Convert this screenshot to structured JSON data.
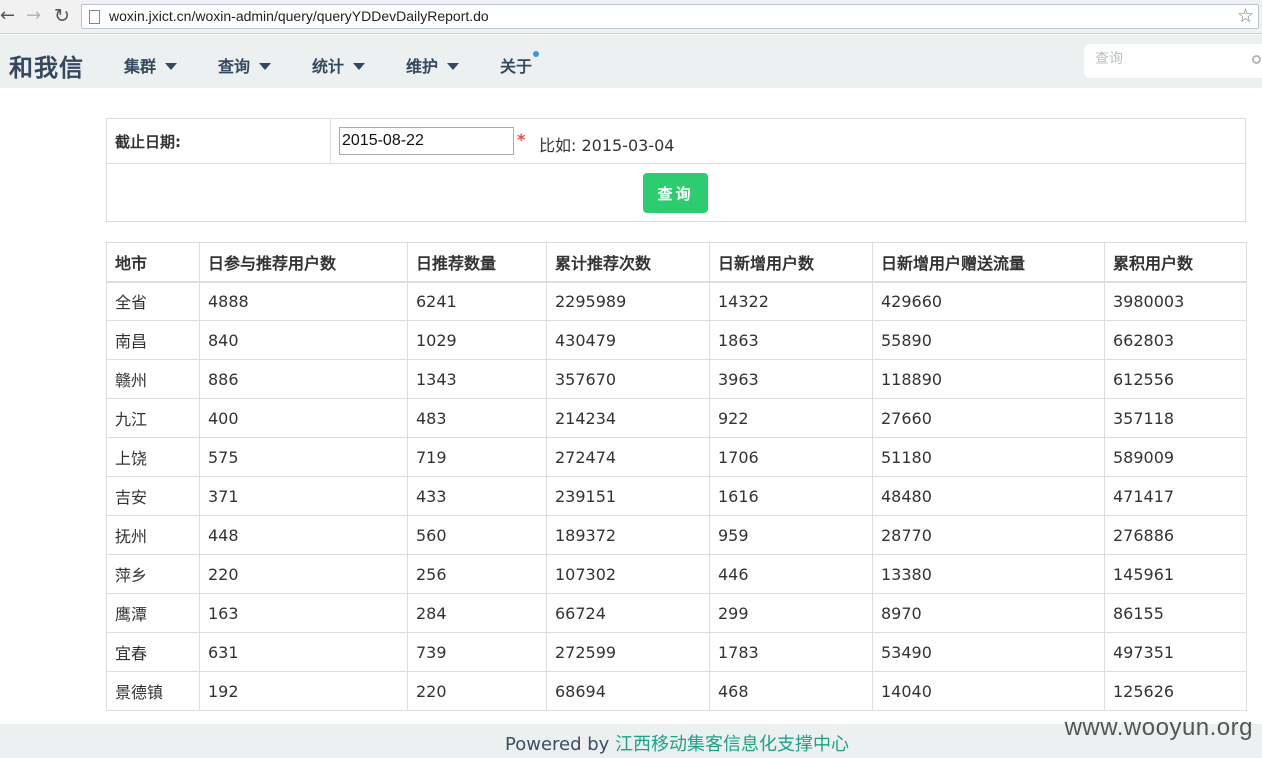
{
  "browser": {
    "url": "woxin.jxict.cn/woxin-admin/query/queryYDDevDailyReport.do"
  },
  "nav": {
    "brand": "和我信",
    "menu": [
      {
        "label": "集群"
      },
      {
        "label": "查询"
      },
      {
        "label": "统计"
      },
      {
        "label": "维护"
      },
      {
        "label": "关于"
      }
    ],
    "search_placeholder": "查询"
  },
  "form": {
    "label": "截止日期:",
    "date_value": "2015-08-22",
    "required_mark": "*",
    "hint": "比如: 2015-03-04",
    "submit_label": "查询"
  },
  "table": {
    "headers": [
      "地市",
      "日参与推荐用户数",
      "日推荐数量",
      "累计推荐次数",
      "日新增用户数",
      "日新增用户赠送流量",
      "累积用户数"
    ],
    "rows": [
      [
        "全省",
        "4888",
        "6241",
        "2295989",
        "14322",
        "429660",
        "3980003"
      ],
      [
        "南昌",
        "840",
        "1029",
        "430479",
        "1863",
        "55890",
        "662803"
      ],
      [
        "赣州",
        "886",
        "1343",
        "357670",
        "3963",
        "118890",
        "612556"
      ],
      [
        "九江",
        "400",
        "483",
        "214234",
        "922",
        "27660",
        "357118"
      ],
      [
        "上饶",
        "575",
        "719",
        "272474",
        "1706",
        "51180",
        "589009"
      ],
      [
        "吉安",
        "371",
        "433",
        "239151",
        "1616",
        "48480",
        "471417"
      ],
      [
        "抚州",
        "448",
        "560",
        "189372",
        "959",
        "28770",
        "276886"
      ],
      [
        "萍乡",
        "220",
        "256",
        "107302",
        "446",
        "13380",
        "145961"
      ],
      [
        "鹰潭",
        "163",
        "284",
        "66724",
        "299",
        "8970",
        "86155"
      ],
      [
        "宜春",
        "631",
        "739",
        "272599",
        "1783",
        "53490",
        "497351"
      ],
      [
        "景德镇",
        "192",
        "220",
        "68694",
        "468",
        "14040",
        "125626"
      ]
    ]
  },
  "footer": {
    "prefix": "Powered by ",
    "link_text": "江西移动集客信息化支撑中心"
  },
  "watermark": "www.wooyun.org"
}
